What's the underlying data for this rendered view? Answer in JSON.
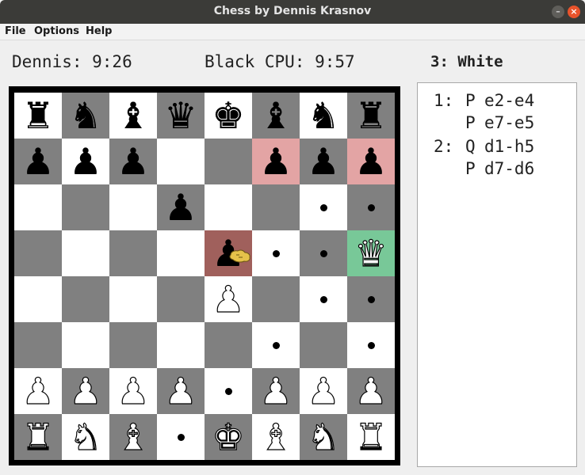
{
  "window": {
    "title": "Chess by Dennis Krasnov",
    "minimize_glyph": "–",
    "close_glyph": "×"
  },
  "menu": [
    "File",
    "Options",
    "Help"
  ],
  "clocks": {
    "white_label": "Dennis: 9:26",
    "black_label": "Black CPU: 9:57"
  },
  "status": "3: White",
  "colors": {
    "light_square": "#ffffff",
    "dark_square": "#808080",
    "last_move_highlight": "#e3a4a4",
    "selected_highlight": "#78c898",
    "frame": "#000000"
  },
  "board": {
    "ranks": [
      [
        "r",
        "n",
        "b",
        "q",
        "k",
        "b",
        "n",
        "r"
      ],
      [
        "p",
        "p",
        "p",
        "",
        "",
        "p",
        "p",
        "p"
      ],
      [
        "",
        "",
        "",
        "p",
        "",
        "",
        "",
        ""
      ],
      [
        "",
        "",
        "",
        "",
        "p",
        "",
        "",
        "Q"
      ],
      [
        "",
        "",
        "",
        "",
        "P",
        "",
        "",
        ""
      ],
      [
        "",
        "",
        "",
        "",
        "",
        "",
        "",
        ""
      ],
      [
        "P",
        "P",
        "P",
        "P",
        "",
        "P",
        "P",
        "P"
      ],
      [
        "R",
        "N",
        "B",
        "",
        "K",
        "B",
        "N",
        "R"
      ]
    ],
    "highlights_red": [
      "f7",
      "h7"
    ],
    "highlight_green": [
      "h5"
    ],
    "highlight_selected": [
      "e5"
    ],
    "move_dots": [
      "g6",
      "h6",
      "f5",
      "g5",
      "g4",
      "h4",
      "f3",
      "h3",
      "e2",
      "d1"
    ]
  },
  "moves": [
    {
      "num": "1:",
      "piece": "P",
      "move": "e2-e4"
    },
    {
      "num": "",
      "piece": "P",
      "move": "e7-e5"
    },
    {
      "num": "2:",
      "piece": "Q",
      "move": "d1-h5"
    },
    {
      "num": "",
      "piece": "P",
      "move": "d7-d6"
    }
  ]
}
